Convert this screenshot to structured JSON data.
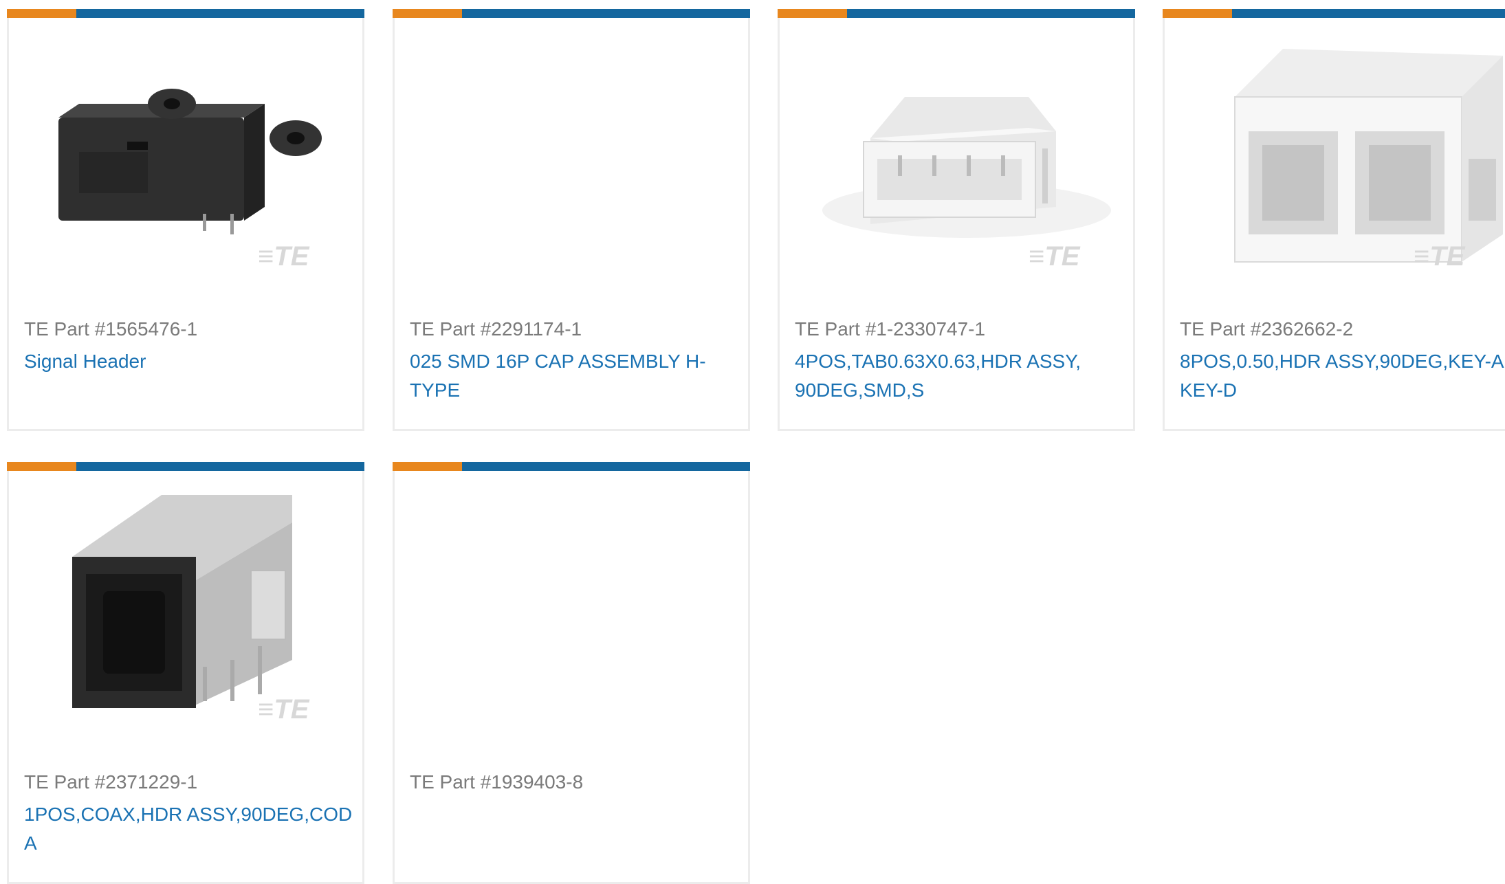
{
  "cards": [
    {
      "part": "TE Part #1565476-1",
      "title": "Signal Header",
      "image": "black-signal-header-image"
    },
    {
      "part": "TE Part #2291174-1",
      "title": "025 SMD 16P CAP ASSEMBLY H-TYPE",
      "image": ""
    },
    {
      "part": "TE Part #1-2330747-1",
      "title": "4POS,TAB0.63X0.63,HDR ASSY, 90DEG,SMD,S",
      "image": "white-4pos-header-image"
    },
    {
      "part": "TE Part #2362662-2",
      "title": "8POS,0.50,HDR ASSY,90DEG,KEY-A, KEY-D",
      "image": "white-8pos-header-image"
    },
    {
      "part": "TE Part #2371229-1",
      "title": "1POS,COAX,HDR ASSY,90DEG,COD A",
      "image": "coax-header-image"
    },
    {
      "part": "TE Part #1939403-8",
      "title": "",
      "image": ""
    }
  ],
  "watermark": "TE",
  "colors": {
    "accent_orange": "#e8871e",
    "accent_blue": "#14679f",
    "link": "#1a72b3",
    "muted_text": "#7a7a7a"
  }
}
